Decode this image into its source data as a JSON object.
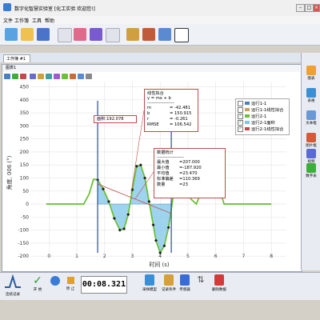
{
  "window": {
    "title": "数字化智慧实验室   [化工实验 欢迎您!]"
  },
  "menu": {
    "items": [
      "文件",
      "工作簿",
      "工具",
      "帮助"
    ]
  },
  "tab": {
    "label": "工作簿 #1"
  },
  "graph": {
    "title": "图表1"
  },
  "area_label": "面积:192.078",
  "linear_fit": {
    "title": "线性拟合",
    "equation": "y = mx + b",
    "separator": "------------------",
    "rows": [
      {
        "key": "m",
        "val": "= -42.481"
      },
      {
        "key": "b",
        "val": "= 150.915"
      },
      {
        "key": "r",
        "val": "= -0.261"
      },
      {
        "key": "RMSE",
        "val": "= 106.542"
      }
    ]
  },
  "stats": {
    "title": "数据统计",
    "separator": "------------------",
    "rows": [
      {
        "key": "最大值",
        "val": "=207.000"
      },
      {
        "key": "最小值",
        "val": "=-187.920"
      },
      {
        "key": "平均值",
        "val": "=23.470"
      },
      {
        "key": "标准偏差",
        "val": "=110.369"
      },
      {
        "key": "数量",
        "val": "=23"
      }
    ]
  },
  "legend": {
    "items": [
      {
        "label": "运行1-1",
        "checked": false,
        "color": "#4a7fc1"
      },
      {
        "label": "运行1-1线性拟合",
        "checked": false,
        "color": "#c8a060"
      },
      {
        "label": "运行2-1",
        "checked": true,
        "color": "#6ac13a"
      },
      {
        "label": "运行2-1面积",
        "checked": true,
        "color": "#7fc6ea"
      },
      {
        "label": "运行2-1线性拟合",
        "checked": true,
        "color": "#c04a4a"
      }
    ]
  },
  "right_panel": {
    "items": [
      {
        "label": "图表",
        "icon": "chart-icon",
        "color": "#f0a030"
      },
      {
        "label": "表格",
        "icon": "table-icon",
        "color": "#3a8fd5"
      },
      {
        "label": "文本框",
        "icon": "textbox-icon",
        "color": "#6a9ad5"
      },
      {
        "label": "图片框",
        "icon": "picture-icon",
        "color": "#d55a3a"
      },
      {
        "label": "视频",
        "icon": "video-icon",
        "color": "#5a6ad5"
      },
      {
        "label": "数字表",
        "icon": "digital-meter-icon",
        "color": "#3ab03a"
      }
    ]
  },
  "bottom": {
    "mode_label": "连续记录",
    "start_label": "开 始",
    "stop_label": "停 止",
    "timer": "00:08.321",
    "buttons": [
      {
        "label": "采样模型",
        "icon": "sampling-model-icon",
        "color": "#3a8fd5"
      },
      {
        "label": "记录条件",
        "icon": "record-condition-icon",
        "color": "#d5a03a"
      },
      {
        "label": "传感器",
        "icon": "sensor-icon",
        "color": "#3a6ad5"
      },
      {
        "label": "",
        "icon": "swap-icon",
        "color": "#555555"
      },
      {
        "label": "删除数据",
        "icon": "delete-data-icon",
        "color": "#d53a3a"
      }
    ]
  },
  "chart_data": {
    "type": "line",
    "xlabel": "时间 (s)",
    "ylabel": "角度, 006 (°)",
    "xlim": [
      -0.9,
      8.6
    ],
    "ylim": [
      -230,
      470
    ],
    "x_ticks": [
      0,
      1,
      2,
      3,
      4,
      5,
      6,
      7,
      8
    ],
    "y_ticks": [
      -200,
      -150,
      -100,
      -50,
      0,
      50,
      100,
      150,
      200,
      250,
      300,
      350,
      400,
      450
    ],
    "grid": true,
    "cursor_x": [
      1.75,
      4.4
    ],
    "series": [
      {
        "name": "运行2-1",
        "color": "#6ac13a",
        "x": [
          -0.1,
          0.0,
          0.5,
          1.0,
          1.25,
          1.45,
          1.6,
          1.75,
          1.95,
          2.15,
          2.35,
          2.55,
          2.7,
          2.85,
          3.0,
          3.15,
          3.3,
          3.45,
          3.6,
          3.75,
          3.85,
          4.0,
          4.15,
          4.3,
          4.45,
          4.6,
          4.75,
          4.9,
          5.1,
          5.3,
          5.5,
          5.7,
          5.9,
          6.1,
          6.3,
          6.5,
          6.7,
          6.9,
          7.1,
          7.3,
          7.5,
          7.8,
          8.0
        ],
        "y": [
          0,
          0,
          0,
          0,
          0,
          40,
          95,
          93,
          58,
          10,
          -55,
          -100,
          -95,
          -40,
          55,
          145,
          150,
          100,
          10,
          -80,
          -140,
          -187,
          -160,
          -90,
          15,
          115,
          160,
          100,
          20,
          0,
          50,
          110,
          115,
          70,
          0,
          0,
          0,
          0,
          0,
          0,
          0,
          0,
          0
        ]
      },
      {
        "name": "运行2-1线性拟合",
        "color": "#c04a4a",
        "slope": -42.481,
        "intercept": 150.915,
        "x_range": [
          1.75,
          4.4
        ]
      }
    ],
    "area": {
      "from": 1.75,
      "to": 4.4,
      "color": "#7fc6ea",
      "value": 192.078
    },
    "points": {
      "from": 1.75,
      "to": 4.4,
      "marker": "diamond",
      "color": "#1a1a1a"
    }
  }
}
